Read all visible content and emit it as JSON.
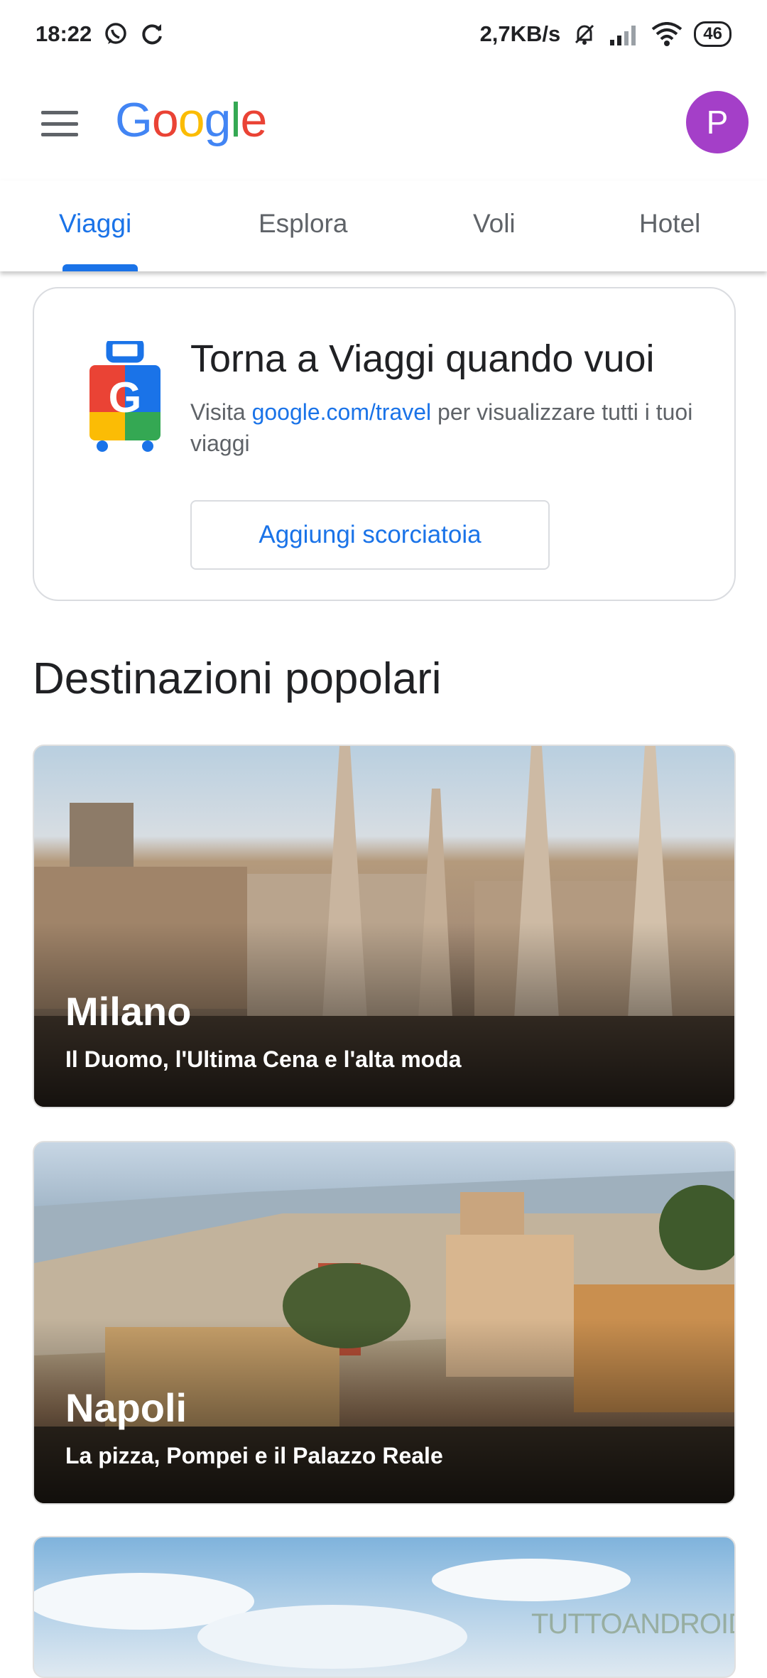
{
  "status_bar": {
    "time": "18:22",
    "speed": "2,7KB/s",
    "battery": "46",
    "icons": [
      "whatsapp-icon",
      "sync-icon",
      "mute-icon",
      "signal-icon",
      "wifi-icon"
    ]
  },
  "app_bar": {
    "logo_letters": [
      "G",
      "o",
      "o",
      "g",
      "l",
      "e"
    ],
    "logo_colors": [
      "#4285F4",
      "#EA4335",
      "#FBBC05",
      "#4285F4",
      "#34A853",
      "#EA4335"
    ],
    "avatar_letter": "P",
    "avatar_color": "#A43FC8"
  },
  "tabs": [
    {
      "label": "Viaggi",
      "active": true
    },
    {
      "label": "Esplora",
      "active": false
    },
    {
      "label": "Voli",
      "active": false
    },
    {
      "label": "Hotel",
      "active": false
    }
  ],
  "promo": {
    "title": "Torna a Viaggi quando vuoi",
    "text_before": "Visita ",
    "link": "google.com/travel",
    "text_after": " per visualizzare tutti i tuoi viaggi",
    "button": "Aggiungi scorciatoia"
  },
  "section_title": "Destinazioni popolari",
  "destinations": [
    {
      "name": "Milano",
      "description": "Il Duomo, l'Ultima Cena e l'alta moda"
    },
    {
      "name": "Napoli",
      "description": "La pizza, Pompei e il Palazzo Reale"
    }
  ],
  "watermark": "TUTTOANDROID",
  "colors": {
    "accent": "#1A73E8",
    "text": "#202124",
    "secondary": "#5F6368"
  }
}
